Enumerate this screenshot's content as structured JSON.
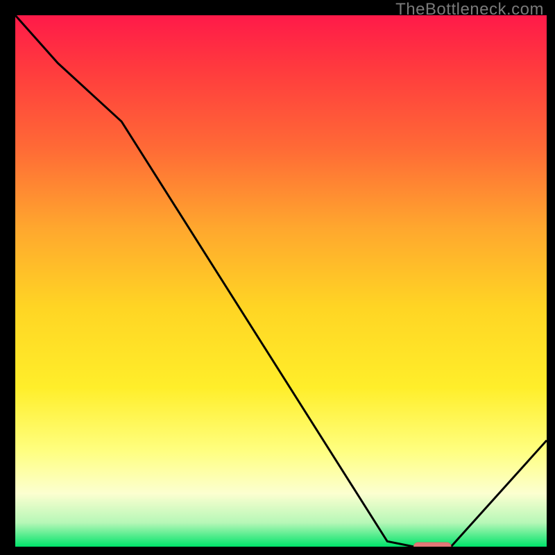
{
  "watermark": "TheBottleneck.com",
  "colors": {
    "frame": "#000000",
    "curve": "#000000",
    "marker_fill": "#e27878",
    "marker_stroke": "#d86a6a",
    "gradient_stops": [
      {
        "offset": 0.0,
        "color": "#ff1a49"
      },
      {
        "offset": 0.1,
        "color": "#ff3a3e"
      },
      {
        "offset": 0.25,
        "color": "#ff6a36"
      },
      {
        "offset": 0.4,
        "color": "#ffa72e"
      },
      {
        "offset": 0.55,
        "color": "#ffd524"
      },
      {
        "offset": 0.7,
        "color": "#ffee2a"
      },
      {
        "offset": 0.82,
        "color": "#ffff80"
      },
      {
        "offset": 0.9,
        "color": "#fcffd0"
      },
      {
        "offset": 0.955,
        "color": "#b6f7b7"
      },
      {
        "offset": 1.0,
        "color": "#00e36a"
      }
    ]
  },
  "chart_data": {
    "type": "line",
    "title": "",
    "xlabel": "",
    "ylabel": "",
    "xlim": [
      0,
      100
    ],
    "ylim": [
      0,
      100
    ],
    "series": [
      {
        "name": "bottleneck-curve",
        "x": [
          0,
          8,
          20,
          70,
          75,
          82,
          100
        ],
        "values": [
          100,
          91,
          80,
          1,
          0,
          0,
          20
        ]
      }
    ],
    "marker": {
      "name": "optimal-zone",
      "x_start": 75,
      "x_end": 82,
      "y": 0
    }
  }
}
